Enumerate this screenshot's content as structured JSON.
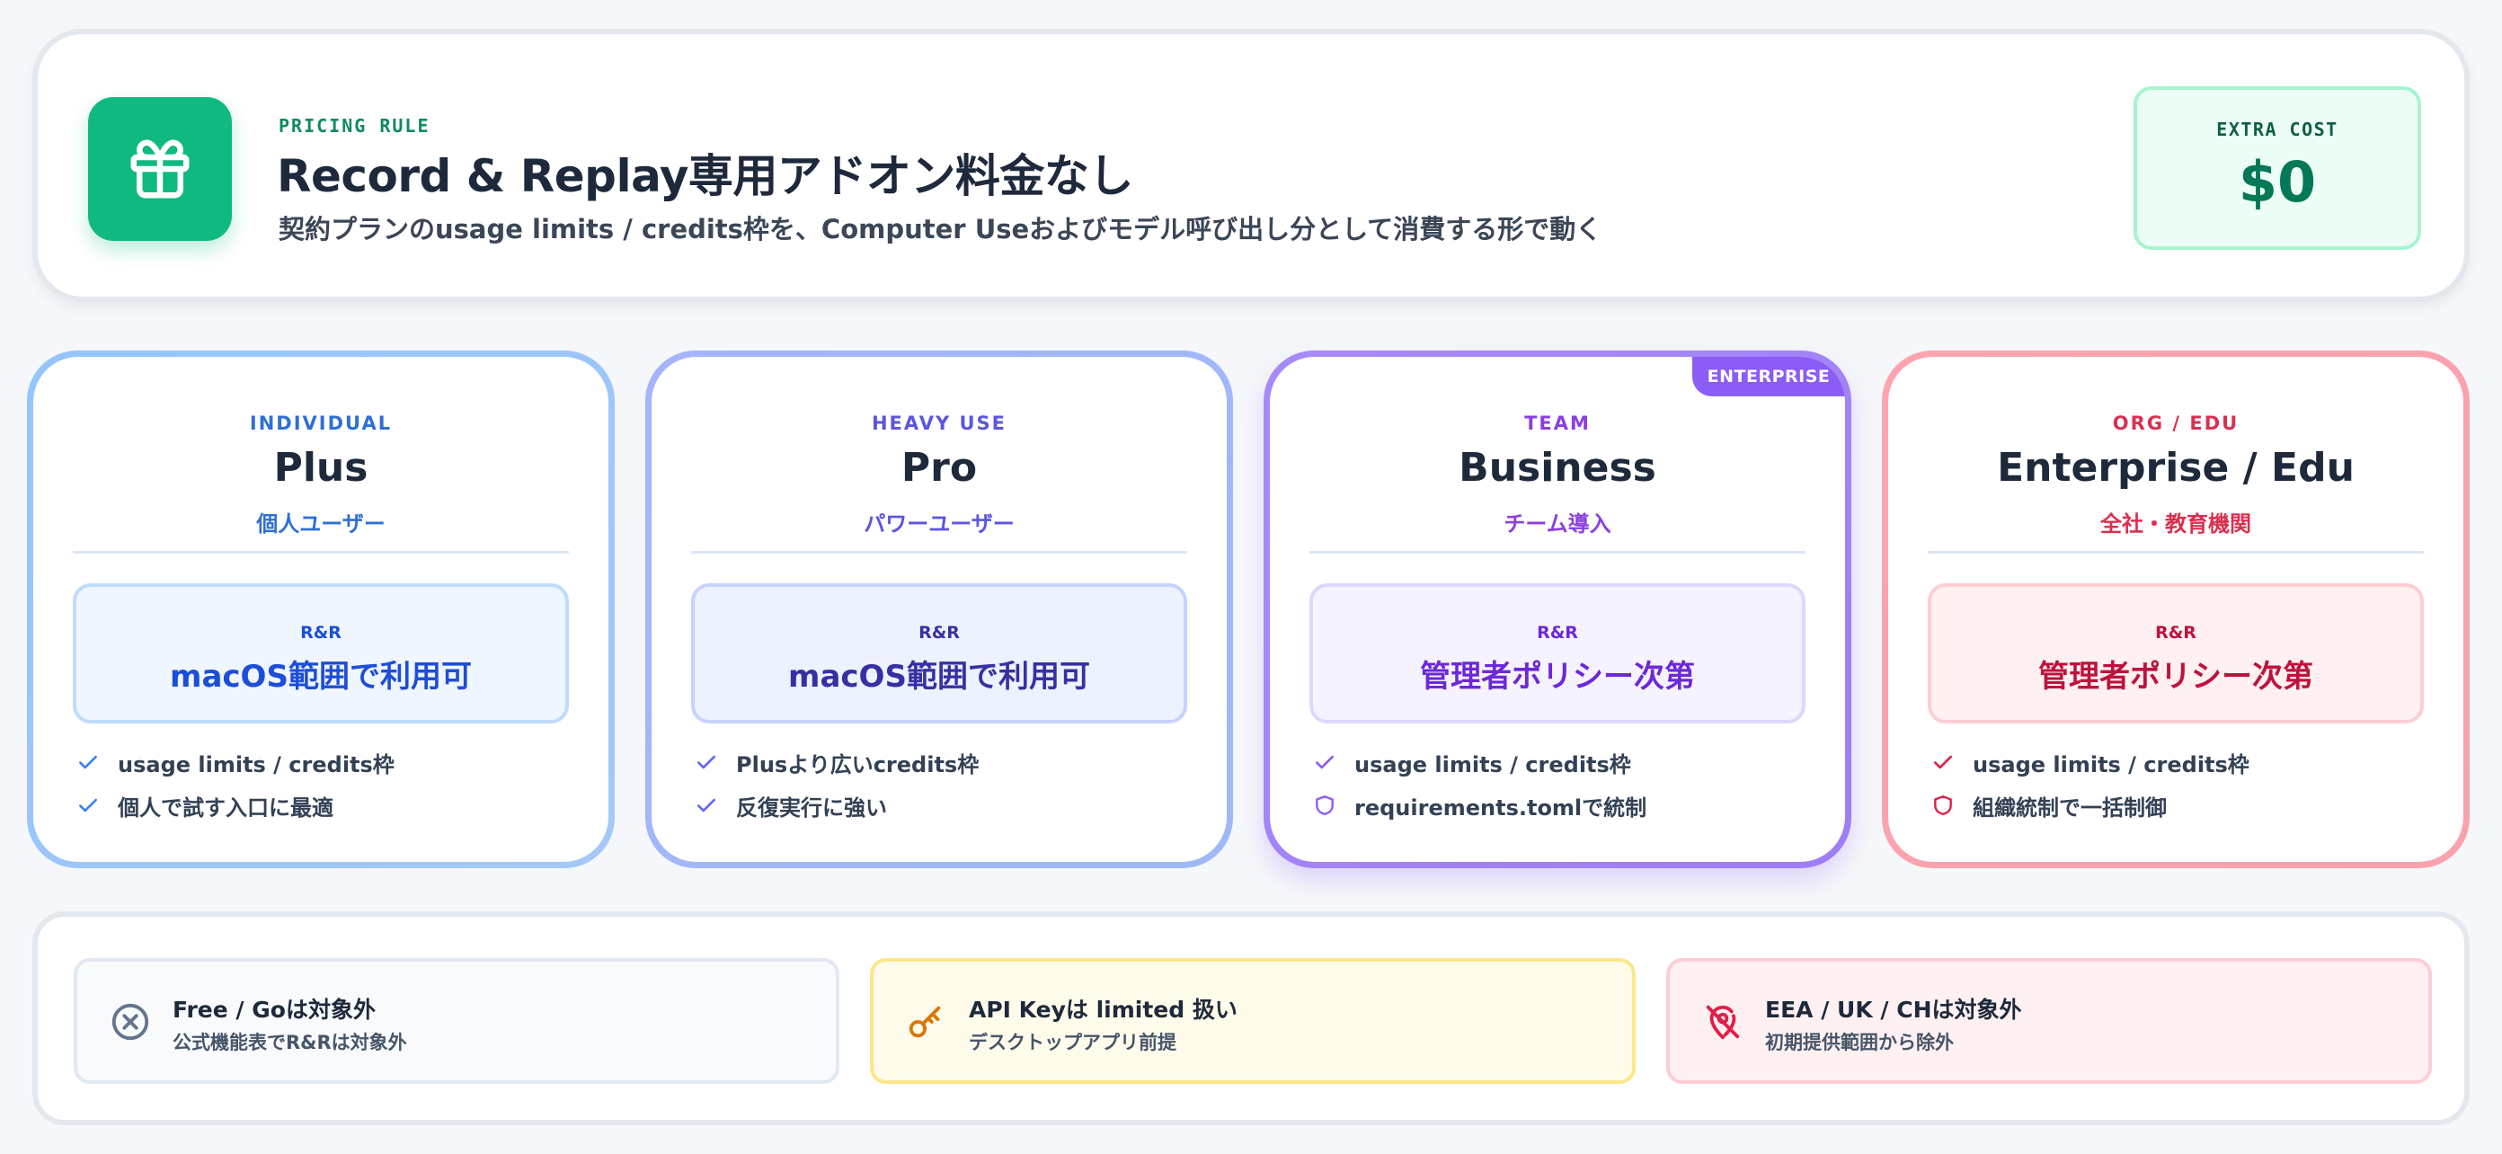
{
  "banner": {
    "kicker": "PRICING RULE",
    "title": "Record & Replay専用アドオン料金なし",
    "subtitle": "契約プランのusage limits / credits枠を、Computer Useおよびモデル呼び出し分として消費する形で動く",
    "icon": "gift-icon",
    "cost_label": "EXTRA COST",
    "cost_value": "$0",
    "accent": "#10b981"
  },
  "plans": [
    {
      "kicker": "INDIVIDUAL",
      "name": "Plus",
      "subtitle": "個人ユーザー",
      "rr_label": "R&R",
      "rr_value": "macOS範囲で利用可",
      "features": [
        {
          "text": "usage limits / credits枠",
          "icon": "check-icon"
        },
        {
          "text": "個人で試す入口に最適",
          "icon": "check-icon"
        }
      ],
      "accent": "#3b82f6"
    },
    {
      "kicker": "HEAVY USE",
      "name": "Pro",
      "subtitle": "パワーユーザー",
      "rr_label": "R&R",
      "rr_value": "macOS範囲で利用可",
      "features": [
        {
          "text": "Plusより広いcredits枠",
          "icon": "check-icon"
        },
        {
          "text": "反復実行に強い",
          "icon": "check-icon"
        }
      ],
      "accent": "#6366f1"
    },
    {
      "kicker": "TEAM",
      "name": "Business",
      "subtitle": "チーム導入",
      "ribbon": "ENTERPRISE",
      "rr_label": "R&R",
      "rr_value": "管理者ポリシー次第",
      "features": [
        {
          "text": "usage limits / credits枠",
          "icon": "check-icon"
        },
        {
          "text": "requirements.tomlで統制",
          "icon": "shield-icon"
        }
      ],
      "accent": "#8b5cf6"
    },
    {
      "kicker": "ORG / EDU",
      "name": "Enterprise / Edu",
      "subtitle": "全社・教育機関",
      "rr_label": "R&R",
      "rr_value": "管理者ポリシー次第",
      "features": [
        {
          "text": "usage limits / credits枠",
          "icon": "check-icon"
        },
        {
          "text": "組織統制で一括制御",
          "icon": "shield-icon"
        }
      ],
      "accent": "#e11d48"
    }
  ],
  "notes": [
    {
      "title": "Free / Goは対象外",
      "subtitle": "公式機能表でR&Rは対象外",
      "icon": "x-circle-icon",
      "color": "#64748b"
    },
    {
      "title": "API Keyは limited 扱い",
      "subtitle": "デスクトップアプリ前提",
      "icon": "key-icon",
      "color": "#d97706"
    },
    {
      "title": "EEA / UK / CHは対象外",
      "subtitle": "初期提供範囲から除外",
      "icon": "location-off-icon",
      "color": "#e11d48"
    }
  ]
}
